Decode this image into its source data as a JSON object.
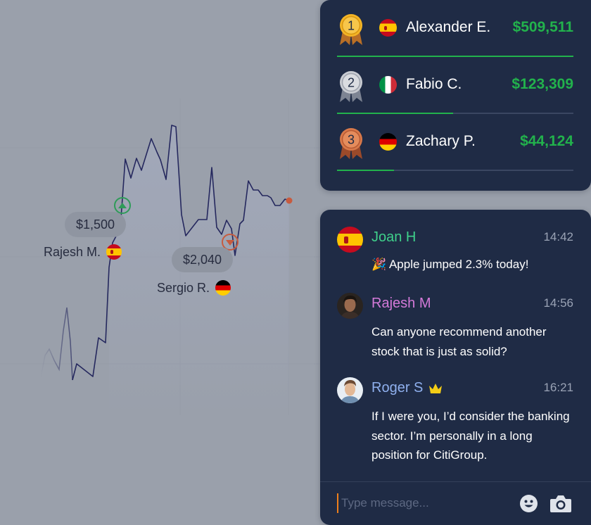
{
  "chart": {
    "line_color": "#25285e",
    "marker_color": "#c75b3f",
    "trades": [
      {
        "amount": "$1,500",
        "trader": "Rajesh M.",
        "flag": "spain-flag",
        "direction": "up",
        "marker_color": "#2e9b58"
      },
      {
        "amount": "$2,040",
        "trader": "Sergio R.",
        "flag": "germany-flag",
        "direction": "down",
        "marker_color": "#c75b3f"
      }
    ]
  },
  "leaderboard": {
    "entries": [
      {
        "rank": "1",
        "name": "Alexander E.",
        "flag": "spain-flag",
        "amount": "$509,511",
        "progress": 1.0,
        "medal": "gold"
      },
      {
        "rank": "2",
        "name": "Fabio C.",
        "flag": "italy-flag",
        "amount": "$123,309",
        "progress": 0.49,
        "medal": "silver"
      },
      {
        "rank": "3",
        "name": "Zachary P.",
        "flag": "germany-flag",
        "amount": "$44,124",
        "progress": 0.24,
        "medal": "bronze"
      }
    ],
    "amount_color": "#22b24c"
  },
  "chat": {
    "messages": [
      {
        "user": "Joan H",
        "user_color": "#3fd08b",
        "time": "14:42",
        "text": "🎉 Apple  jumped 2.3% today!",
        "avatar": "spain-flag-avatar"
      },
      {
        "user": "Rajesh M",
        "user_color": "#d47ad9",
        "time": "14:56",
        "text": "Can anyone recommend another stock that is just as solid?",
        "avatar": "user-photo-avatar"
      },
      {
        "user": "Roger S",
        "user_color": "#8fb0ee",
        "time": "16:21",
        "text": "If I were you, I’d consider the banking sector. I’m personally in a long position for CitiGroup.",
        "avatar": "user-photo-avatar",
        "badge": "crown-icon"
      }
    ],
    "input_placeholder": "Type message...",
    "icons": [
      "emoji-icon",
      "camera-icon"
    ]
  }
}
